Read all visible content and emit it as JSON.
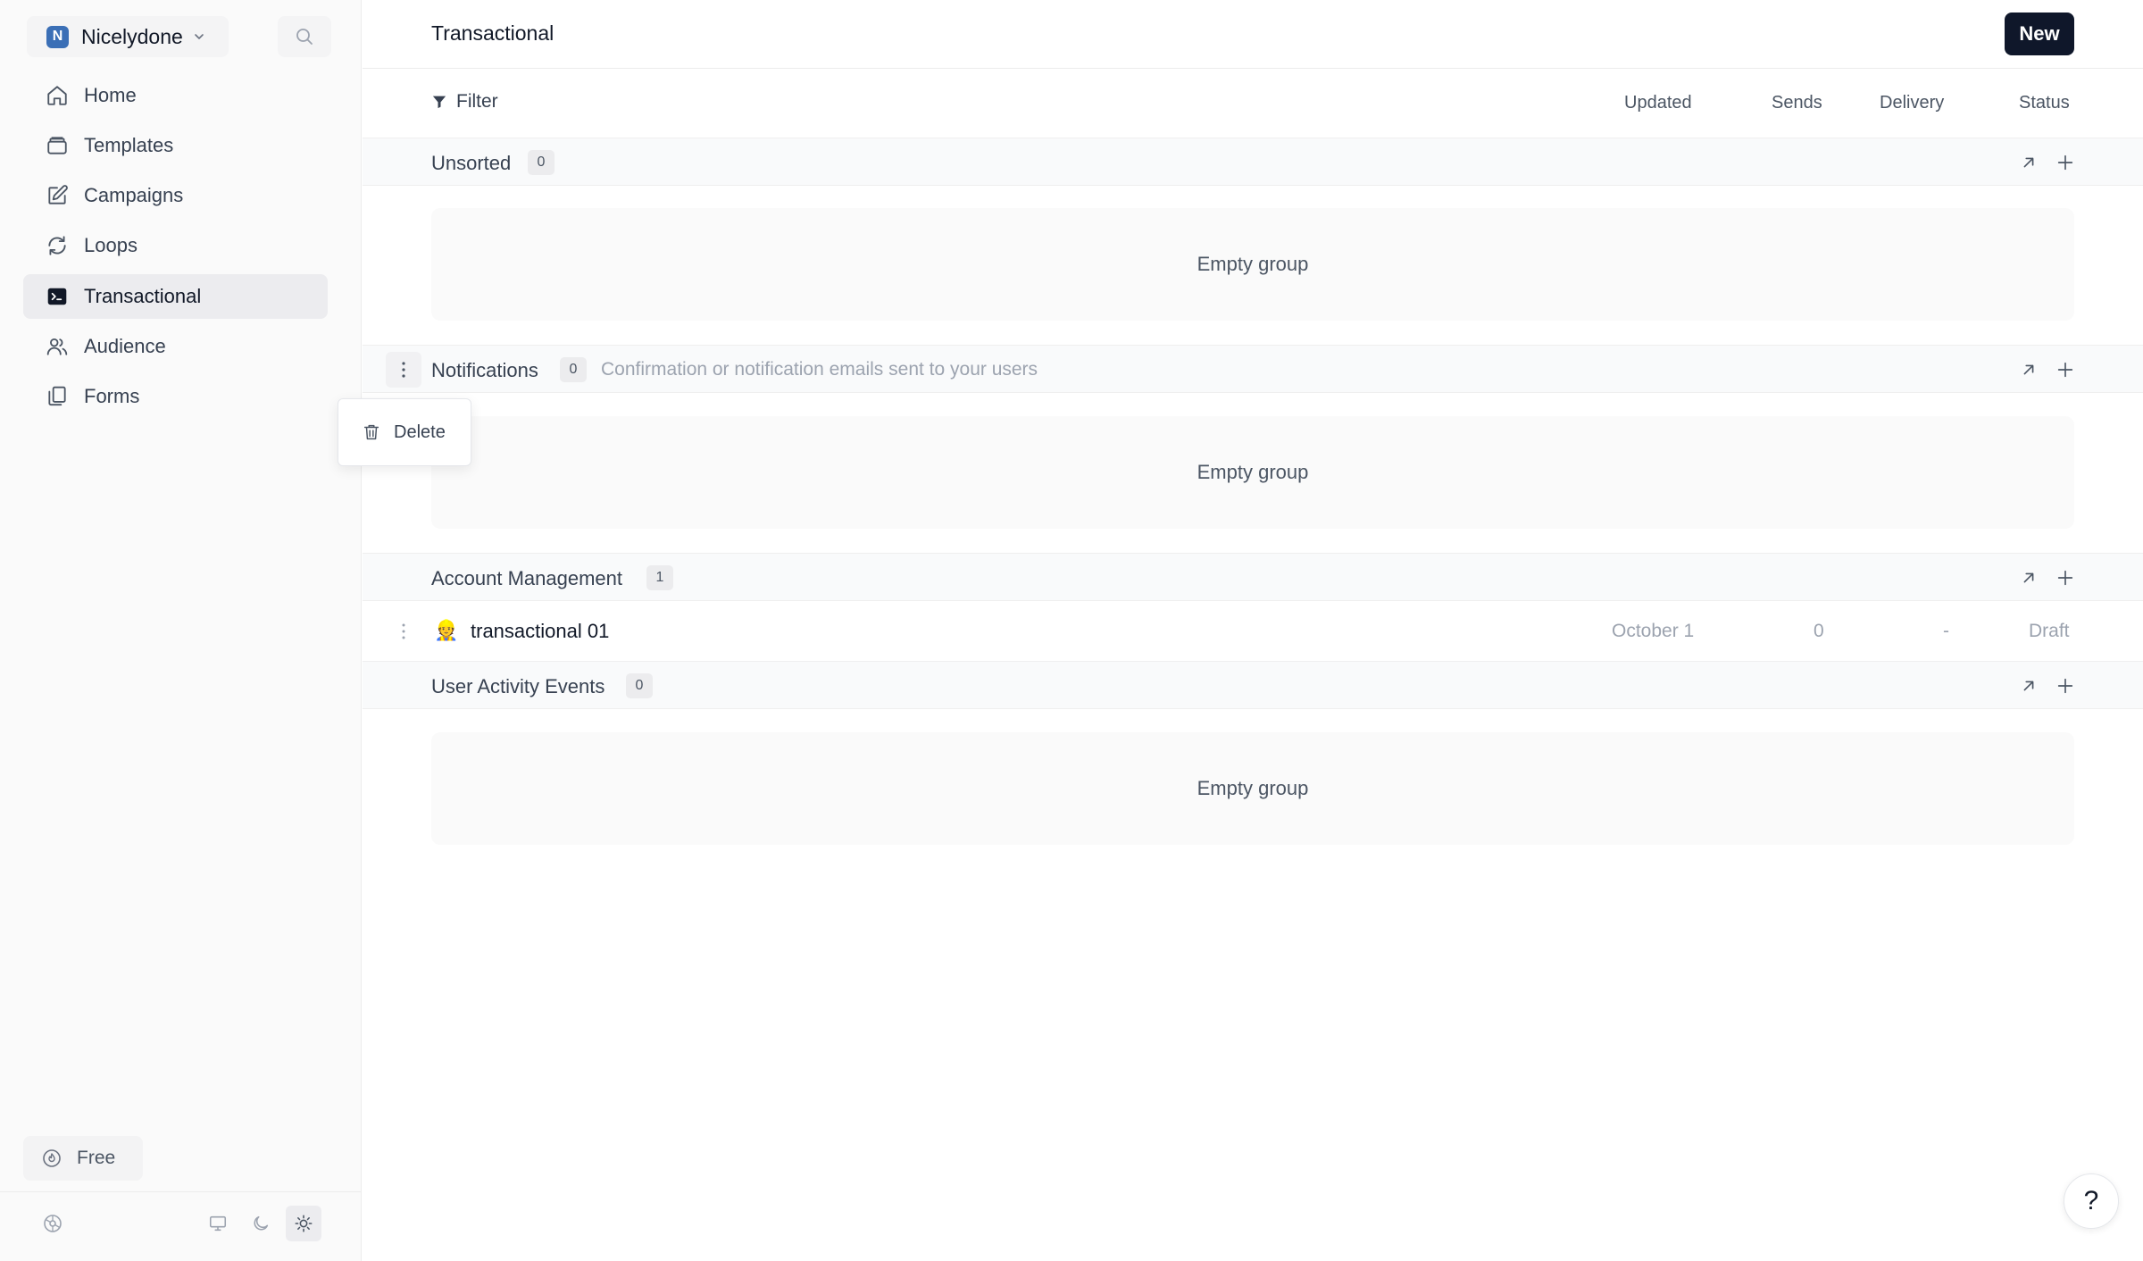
{
  "sidebar": {
    "workspace": {
      "initial": "N",
      "name": "Nicelydone"
    },
    "nav": [
      {
        "label": "Home",
        "icon": "home-icon"
      },
      {
        "label": "Templates",
        "icon": "templates-icon"
      },
      {
        "label": "Campaigns",
        "icon": "campaigns-icon"
      },
      {
        "label": "Loops",
        "icon": "loops-icon"
      },
      {
        "label": "Transactional",
        "icon": "terminal-icon",
        "active": true
      },
      {
        "label": "Audience",
        "icon": "users-icon"
      },
      {
        "label": "Forms",
        "icon": "forms-icon"
      }
    ],
    "plan_label": "Free"
  },
  "header": {
    "title": "Transactional",
    "new_label": "New"
  },
  "filterbar": {
    "filter_label": "Filter",
    "columns": [
      "Updated",
      "Sends",
      "Delivery",
      "Status"
    ]
  },
  "groups": [
    {
      "name": "Unsorted",
      "count": "0",
      "empty_label": "Empty group"
    },
    {
      "name": "Notifications",
      "count": "0",
      "description": "Confirmation or notification emails sent to your users",
      "empty_label": "Empty group"
    },
    {
      "name": "Account Management",
      "count": "1"
    },
    {
      "name": "User Activity Events",
      "count": "0",
      "empty_label": "Empty group"
    }
  ],
  "row": {
    "emoji": "👷",
    "name": "transactional 01",
    "updated": "October 1",
    "sends": "0",
    "delivery": "-",
    "status": "Draft"
  },
  "context_menu": {
    "delete_label": "Delete"
  },
  "help_label": "?",
  "colors": {
    "accent": "#0f172a",
    "workspace_badge": "#3b6fb6"
  }
}
